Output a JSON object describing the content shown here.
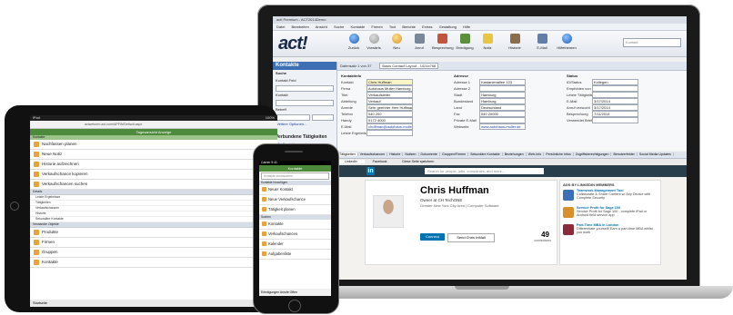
{
  "laptop": {
    "window_title": "act! Premium - ACT2014Demo",
    "menu": [
      "Datei",
      "Bearbeiten",
      "Ansicht",
      "Suche",
      "Kontakte",
      "Firmen",
      "Tool",
      "Berichte",
      "Extras",
      "Gestaltung",
      "Hilfe"
    ],
    "logo": "act!",
    "toolbar_buttons": [
      "Zurück",
      "Vorwärts",
      "Neu",
      "Anruf",
      "Besprechung",
      "Erledigung",
      "Notiz",
      "Historie",
      "E-Mail",
      "Hilfethemen"
    ],
    "search_placeholder": "Kontakt",
    "left_pane": {
      "title": "Kontakte",
      "section": "Suche",
      "fields": [
        {
          "label": "Kontakt Feld"
        },
        {
          "label": "Kontakt"
        },
        {
          "label": "Betreff"
        }
      ],
      "more_options": "Weitere Optionen...",
      "tasks_title": "Verbundene Tätigkeiten",
      "task_items": [
        "Alle Kontakte anzeigen",
        "Neuen Kontakt",
        "Kontaktliste drucken",
        "Verbundene Tätigkeiten"
      ]
    },
    "detail": {
      "header_nav": "Datensatz 1 von 37",
      "layout": "Basis Contact Layout - 1024x768",
      "col1_title": "Kontaktinfo",
      "col1": [
        {
          "label": "Kontakt",
          "value": "Chris Huffman"
        },
        {
          "label": "Firma",
          "value": "Autohaus Muller Hamburg"
        },
        {
          "label": "Titel",
          "value": "Verkaufsleiter"
        },
        {
          "label": "Abteilung",
          "value": "Verkauf"
        },
        {
          "label": "Anrede",
          "value": "Sehr geehrter Herr Huffman"
        },
        {
          "label": "Telefon",
          "value": "040 200"
        },
        {
          "label": "Handy",
          "value": "0172 4000"
        },
        {
          "label": "E-Mail",
          "value": "chuffman@autohaus-muller.com"
        },
        {
          "label": "Letzte Ergebnisse",
          "value": ""
        }
      ],
      "col2_title": "Adresse",
      "col2": [
        {
          "label": "Adresse 1",
          "value": "Kastanienallee 123"
        },
        {
          "label": "Adresse 2",
          "value": ""
        },
        {
          "label": "Stadt",
          "value": "Hamburg"
        },
        {
          "label": "Bundesland",
          "value": "Hamburg"
        },
        {
          "label": "Land",
          "value": "Deutschland"
        },
        {
          "label": "Fax",
          "value": "040 20000"
        },
        {
          "label": "Private E-Mail",
          "value": ""
        },
        {
          "label": "Webseite",
          "value": "www.autohaus-muller.de"
        }
      ],
      "col3_title": "Status",
      "col3": [
        {
          "label": "ID/Status",
          "value": "Kollegen"
        },
        {
          "label": "Empfohlen von",
          "value": ""
        },
        {
          "label": "Letzte Tätigkeiten",
          "value": ""
        },
        {
          "label": "E-Mail",
          "value": "3/17/2014"
        },
        {
          "label": "Anruf versucht",
          "value": "3/17/2014"
        },
        {
          "label": "Besprechung",
          "value": "7/11/2014"
        },
        {
          "label": "Verwendet Brief",
          "value": ""
        }
      ]
    },
    "tabs": [
      "Tätigkeiten",
      "Verkaufschancen",
      "Historie",
      "Notizen",
      "Dokumente",
      "Gruppen/Firmen",
      "Sekundäre Kontakte",
      "Beziehungen",
      "Web-Info",
      "Persönliche Infos",
      "Zugriffsberechtigungen",
      "Benutzerfelder",
      "Social Media Updates"
    ],
    "browser_tabs": [
      "LinkedIn",
      "Facebook",
      "Diese Seite speichern"
    ],
    "linkedin": {
      "logo": "in",
      "search_placeholder": "Search for people, jobs, companies, and more...",
      "name": "Chris Huffman",
      "headline": "Owner at CH TechONE",
      "location": "Greater New York City Area | Computer Software",
      "connect": "Connect",
      "send_inmail": "Send Chris InMail",
      "connections_count": "49",
      "connections_label": "connections",
      "ads_title": "ADS BY LINKEDIN MEMBERS",
      "ads": [
        {
          "title": "Teamwork Management Tool",
          "text": "Collaborate & Share Content w/ Any Device with Complete Security",
          "color": "#3b6fb6"
        },
        {
          "title": "Service Profit for Sage 100",
          "text": "Service Profit for Sage 100 - complete iPad or Android field service app",
          "color": "#d9902b"
        },
        {
          "title": "Part-Time MBA in London",
          "text": "Differentiate yourself! Earn a part-time MBA whilst you work",
          "color": "#8b2a3a"
        }
      ]
    }
  },
  "tablet": {
    "status_left": "iPad",
    "status_right": "100%",
    "url": "actwebcrm.act.com/APFW/Default.aspx",
    "header": "Tagesansicht Anzeige",
    "subheader": "Kontakte",
    "rows": [
      "Nachfassen planen",
      "Neue Notiz",
      "Historie aufzeichnen",
      "Verkaufschance kopieren",
      "Verkaufschancen suchen"
    ],
    "section1": "Details",
    "small_rows": [
      "Letzte Ergebnisse",
      "Tätigkeiten",
      "Verkaufschancen",
      "Historie",
      "Sekundäre Kontakte"
    ],
    "section2": "Verwandte Objekte",
    "rows2": [
      "Produkte",
      "Firmen",
      "Gruppen",
      "Kontakte"
    ],
    "bottom": "Startseite"
  },
  "phone": {
    "status": "Carrier 9:41",
    "header": "Kontakte",
    "search_placeholder": "Kontakte durchsuchen",
    "section1": "Kontakte hinzufügen",
    "rows": [
      "Neuer Kontakt",
      "Neue Verkaufschance",
      "Tätigkeit planen"
    ],
    "section2": "Suchen",
    "rows2": [
      "Kontakte",
      "Verkaufschancen",
      "Kalender",
      "Aufgabenliste"
    ],
    "footer": "Erledigungen Anrufe Offen"
  }
}
